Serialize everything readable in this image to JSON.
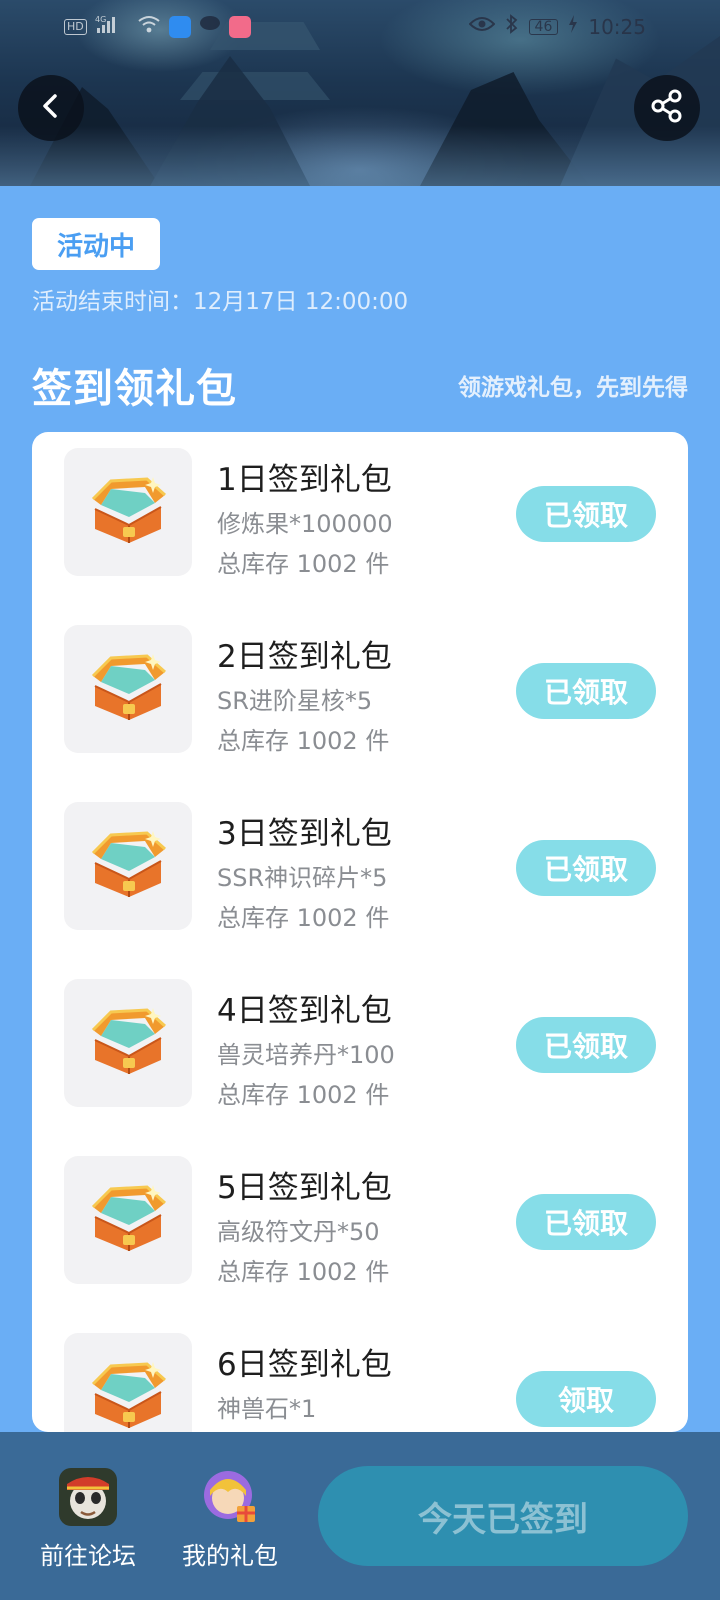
{
  "status_bar": {
    "time": "10:25",
    "network_label": "HD",
    "signal_label": "4G",
    "battery": "46"
  },
  "activity": {
    "status_badge": "活动中",
    "end_time_label": "活动结束时间：",
    "end_time_value": "12月17日 12:00:00"
  },
  "section": {
    "title": "签到领礼包",
    "subtitle": "领游戏礼包，先到先得"
  },
  "gifts": [
    {
      "title": "1日签到礼包",
      "desc": "修炼果*100000",
      "stock": "总库存 1002 件",
      "button": "已领取"
    },
    {
      "title": "2日签到礼包",
      "desc": "SR进阶星核*5",
      "stock": "总库存 1002 件",
      "button": "已领取"
    },
    {
      "title": "3日签到礼包",
      "desc": "SSR神识碎片*5",
      "stock": "总库存 1002 件",
      "button": "已领取"
    },
    {
      "title": "4日签到礼包",
      "desc": "兽灵培养丹*100",
      "stock": "总库存 1002 件",
      "button": "已领取"
    },
    {
      "title": "5日签到礼包",
      "desc": "高级符文丹*50",
      "stock": "总库存 1002 件",
      "button": "已领取"
    },
    {
      "title": "6日签到礼包",
      "desc": "神兽石*1",
      "stock": "",
      "button": "领取"
    }
  ],
  "bottom_nav": {
    "forum_label": "前往论坛",
    "my_gifts_label": "我的礼包",
    "signed_button": "今天已签到"
  },
  "colors": {
    "page_bg": "#6aaef5",
    "claim_button": "#86dde8",
    "bottom_bar": "#3a6a97",
    "signed_button": "#2e8fb0",
    "badge_text": "#4a9ef2"
  }
}
